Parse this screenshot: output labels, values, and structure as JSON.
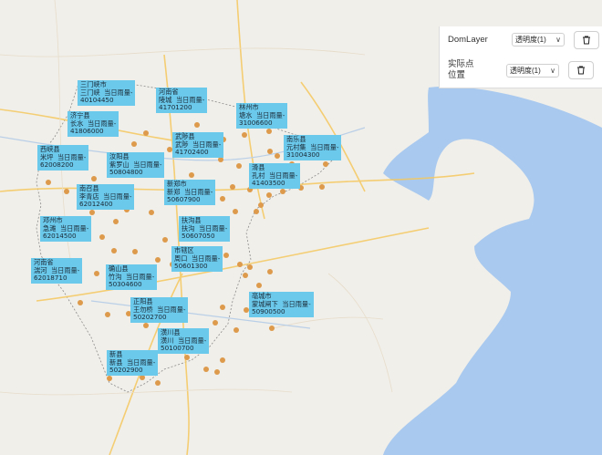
{
  "colors": {
    "label_bg": "#6bc9ec",
    "dot": "#dd9a4c",
    "sea": "#a9c9ef",
    "land": "#f1efe9",
    "road": "#f5c85f"
  },
  "layers": [
    {
      "name": "DomLayer",
      "opacity_select": "透明度(1)",
      "delete_icon": "trash-icon"
    },
    {
      "name": "实际点\n位置",
      "opacity_select": "透明度(1)",
      "delete_icon": "trash-icon"
    }
  ],
  "stations": [
    {
      "name": "三门峡市",
      "site": "三门峡",
      "rain": "当日雨量-",
      "code": "40104450"
    },
    {
      "name": "济宁县",
      "site": "长水",
      "rain": "当日雨量-",
      "code": "41806000"
    },
    {
      "name": "河南省",
      "site": "陵城",
      "rain": "当日雨量-",
      "code": "41701200"
    },
    {
      "name": "林州市",
      "site": "塘水",
      "rain": "当日雨量-",
      "code": "31006600"
    },
    {
      "name": "西峡县",
      "site": "米坪",
      "rain": "当日雨量-",
      "code": "62008200"
    },
    {
      "name": "汝阳县",
      "site": "紫罗山",
      "rain": "当日雨量-",
      "code": "50804800"
    },
    {
      "name": "武陟县",
      "site": "武陟",
      "rain": "当日雨量-",
      "code": "41702400"
    },
    {
      "name": "南乐县",
      "site": "元村集",
      "rain": "当日雨量-",
      "code": "31004300"
    },
    {
      "name": "滑县",
      "site": "孔村",
      "rain": "当日雨量-",
      "code": "41403500"
    },
    {
      "name": "南召县",
      "site": "李青店",
      "rain": "当日雨量-",
      "code": "62012400"
    },
    {
      "name": "新郑市",
      "site": "新郑",
      "rain": "当日雨量-",
      "code": "50607900"
    },
    {
      "name": "邓州市",
      "site": "急滩",
      "rain": "当日雨量-",
      "code": "62014500"
    },
    {
      "name": "扶沟县",
      "site": "扶沟",
      "rain": "当日雨量-",
      "code": "50607050"
    },
    {
      "name": "市辖区",
      "site": "周口",
      "rain": "当日雨量-",
      "code": "50601300"
    },
    {
      "name": "河南省",
      "site": "湍河",
      "rain": "当日雨量-",
      "code": "62018710"
    },
    {
      "name": "确山县",
      "site": "竹沟",
      "rain": "当日雨量-",
      "code": "50304600"
    },
    {
      "name": "亳城市",
      "site": "蒙城闸下",
      "rain": "当日雨量-",
      "code": "50900500"
    },
    {
      "name": "正阳县",
      "site": "王勿桥",
      "rain": "当日雨量-",
      "code": "50202700"
    },
    {
      "name": "潢川县",
      "site": "潢川",
      "rain": "当日雨量-",
      "code": "50100700"
    },
    {
      "name": "新县",
      "site": "新县",
      "rain": "当日雨量-",
      "code": "50202900"
    }
  ]
}
